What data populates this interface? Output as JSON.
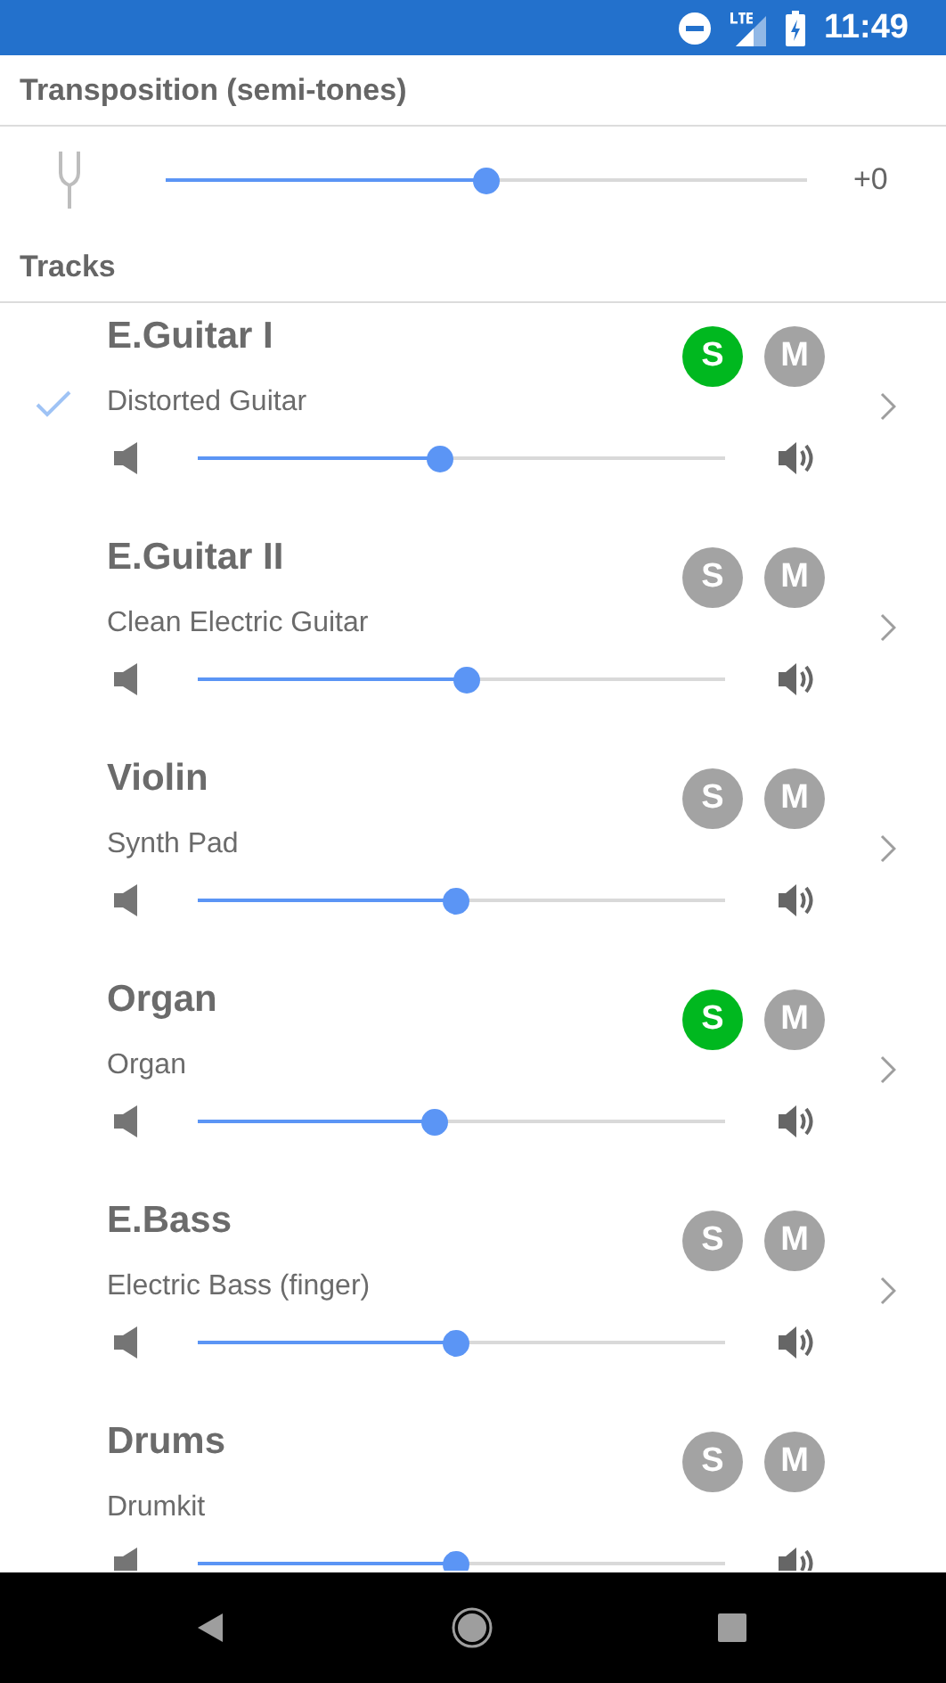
{
  "status_bar": {
    "time": "11:49"
  },
  "transposition": {
    "title": "Transposition (semi-tones)",
    "level": 0.5,
    "reading": "+0"
  },
  "tracks_header": "Tracks",
  "tracks": [
    {
      "name": "E.Guitar I",
      "instrument": "Distorted Guitar",
      "checked": true,
      "solo": true,
      "mute": false,
      "solo_label": "S",
      "mute_label": "M",
      "level": 0.46,
      "chevron": true
    },
    {
      "name": "E.Guitar II",
      "instrument": "Clean Electric Guitar",
      "checked": false,
      "solo": false,
      "mute": false,
      "solo_label": "S",
      "mute_label": "M",
      "level": 0.51,
      "chevron": true
    },
    {
      "name": "Violin",
      "instrument": "Synth Pad",
      "checked": false,
      "solo": false,
      "mute": false,
      "solo_label": "S",
      "mute_label": "M",
      "level": 0.49,
      "chevron": true
    },
    {
      "name": "Organ",
      "instrument": "Organ",
      "checked": false,
      "solo": true,
      "mute": false,
      "solo_label": "S",
      "mute_label": "M",
      "level": 0.45,
      "chevron": true
    },
    {
      "name": "E.Bass",
      "instrument": "Electric Bass (finger)",
      "checked": false,
      "solo": false,
      "mute": false,
      "solo_label": "S",
      "mute_label": "M",
      "level": 0.49,
      "chevron": true
    },
    {
      "name": "Drums",
      "instrument": "Drumkit",
      "checked": false,
      "solo": false,
      "mute": false,
      "solo_label": "S",
      "mute_label": "M",
      "level": 0.49,
      "chevron": false
    }
  ]
}
